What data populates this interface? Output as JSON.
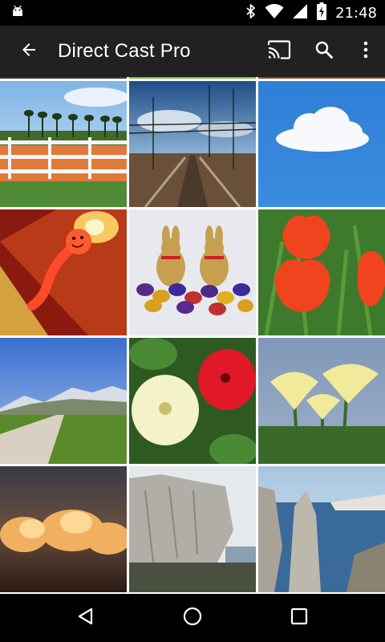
{
  "status_bar": {
    "time": "21:48",
    "icons": [
      "android-debug-icon",
      "bluetooth-icon",
      "wifi-icon",
      "signal-icon",
      "battery-charging-icon"
    ]
  },
  "app_bar": {
    "title": "Direct Cast Pro",
    "back_icon": "arrow-back-icon",
    "actions": [
      "cast-icon",
      "search-icon",
      "more-vert-icon"
    ]
  },
  "grid": {
    "columns": 3,
    "photos": [
      {
        "subject": "palm trees and white fence"
      },
      {
        "subject": "railway tracks"
      },
      {
        "subject": "cloud in blue sky"
      },
      {
        "subject": "candle figure"
      },
      {
        "subject": "chocolate bunnies and eggs"
      },
      {
        "subject": "red tulips"
      },
      {
        "subject": "mountain road"
      },
      {
        "subject": "white and red petunias"
      },
      {
        "subject": "yellow flowers"
      },
      {
        "subject": "sunset clouds"
      },
      {
        "subject": "chalk cliffs"
      },
      {
        "subject": "sea stack cliffs"
      }
    ]
  },
  "nav_bar": {
    "buttons": [
      "back-triangle-icon",
      "home-circle-icon",
      "recents-square-icon"
    ]
  },
  "colors": {
    "status_bar": "#000000",
    "app_bar": "#212121",
    "grid_gap": "#ffffff",
    "nav_bar": "#000000"
  }
}
